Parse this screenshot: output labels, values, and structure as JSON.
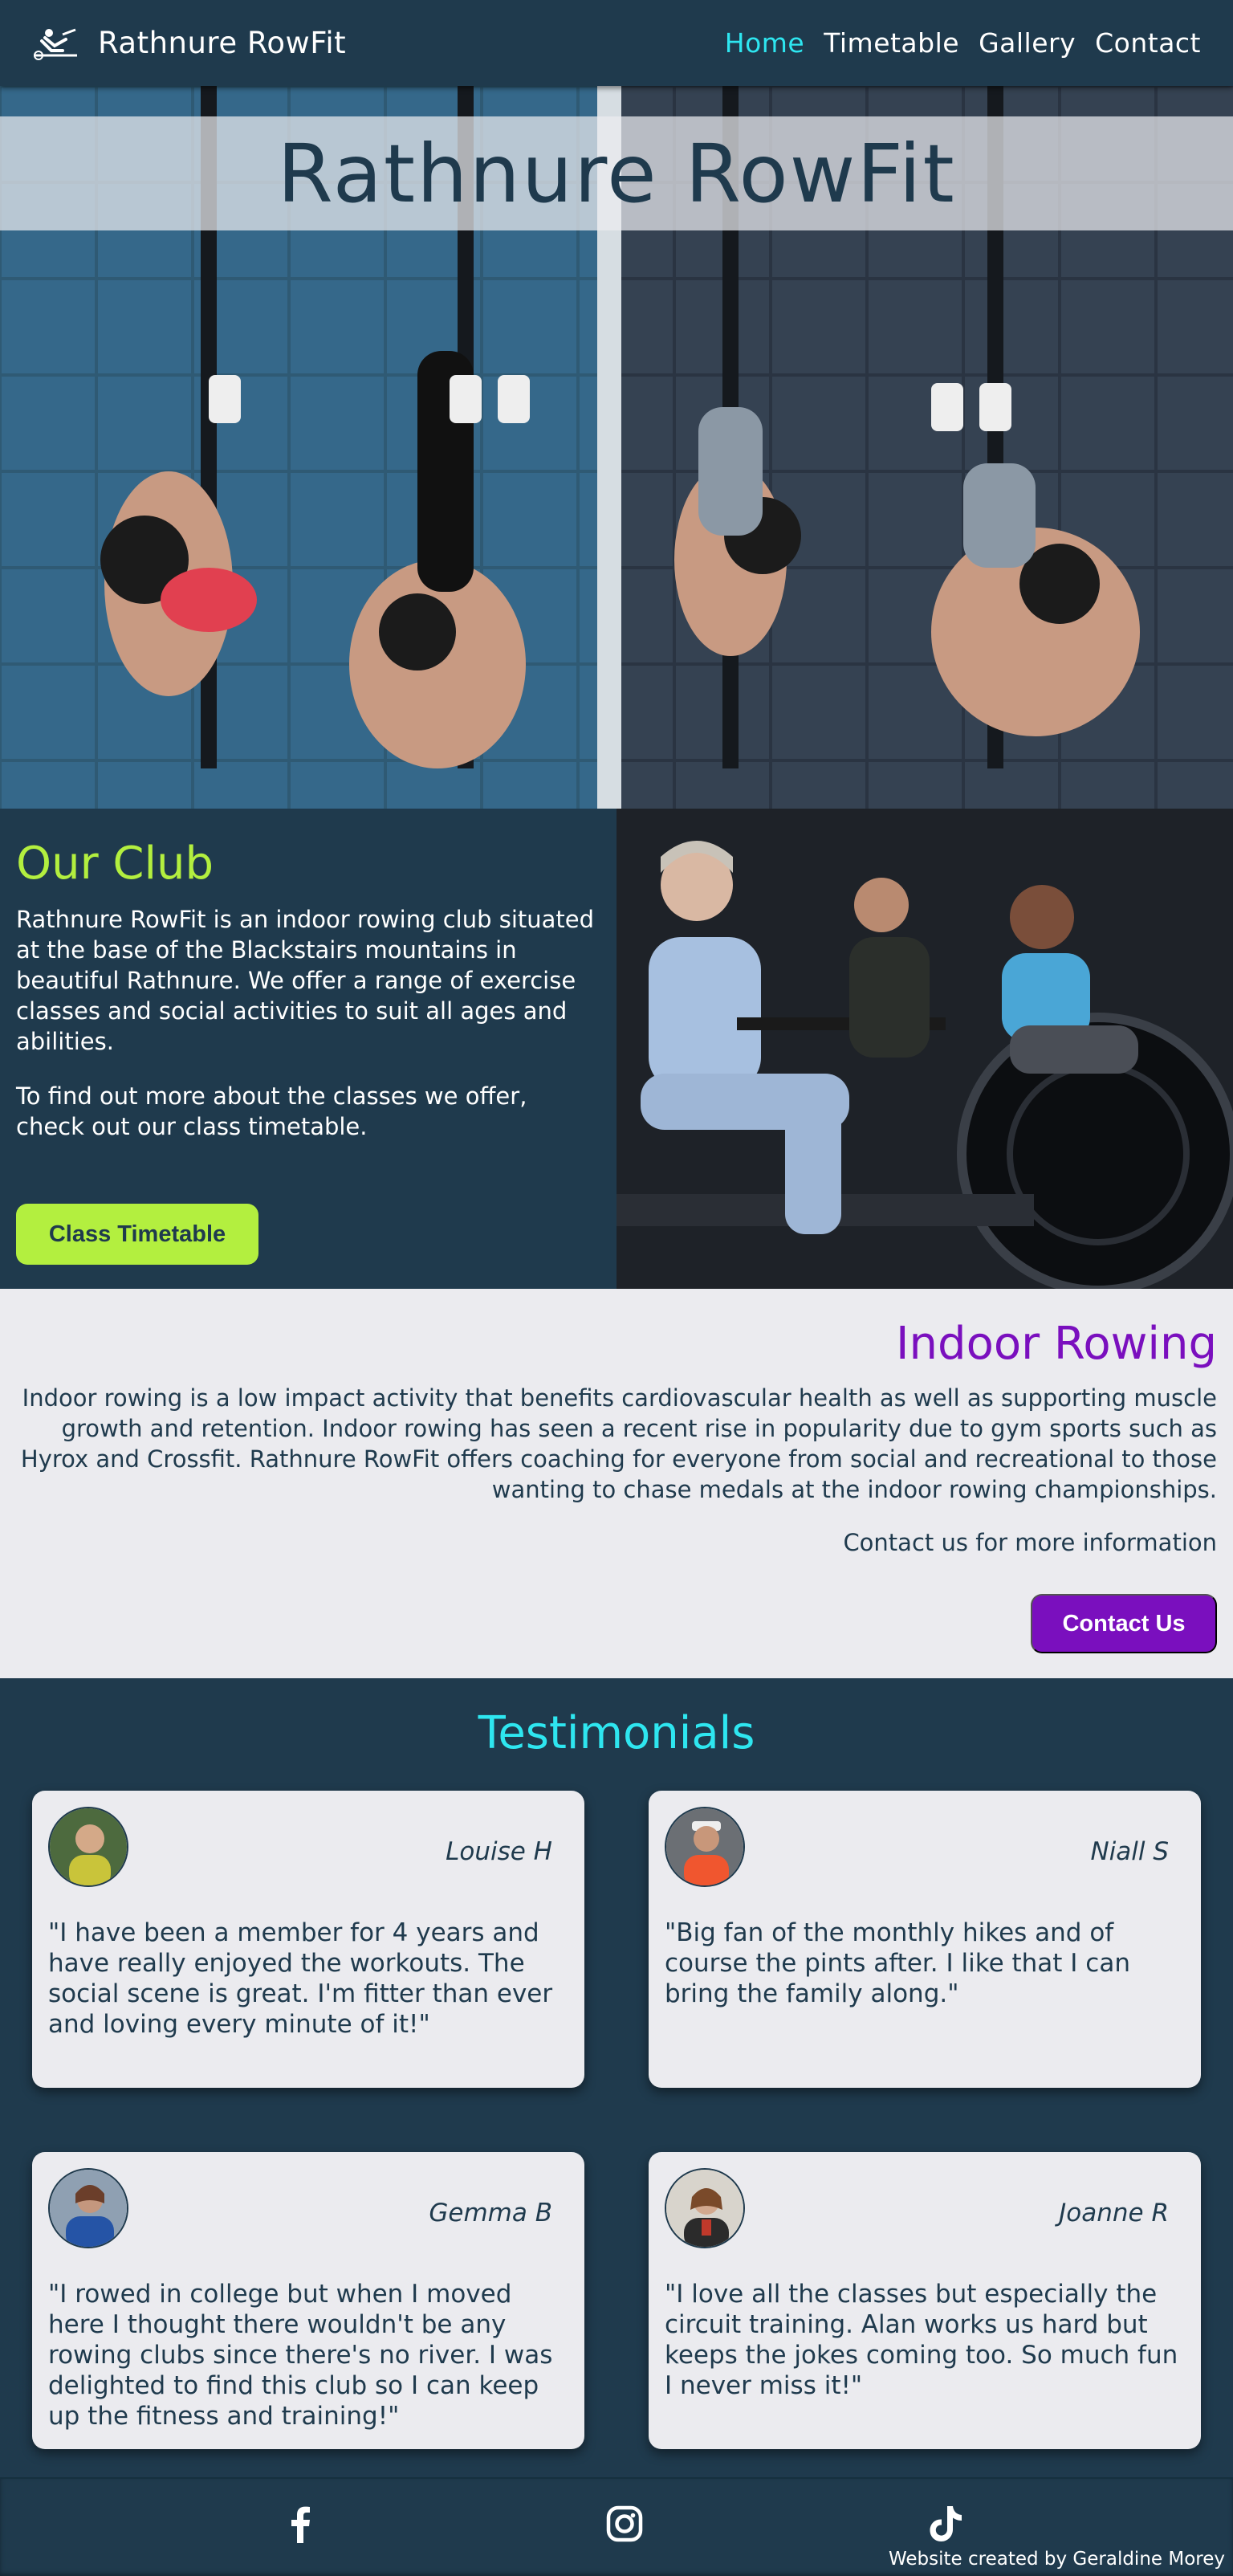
{
  "nav": {
    "brand": "Rathnure RowFit",
    "links": [
      "Home",
      "Timetable",
      "Gallery",
      "Contact"
    ]
  },
  "hero": {
    "title": "Rathnure RowFit"
  },
  "club": {
    "heading": "Our Club",
    "para1": "Rathnure RowFit is an indoor rowing club situated at the base of the Blackstairs mountains in beautiful Rathnure. We offer a range of exercise classes and social activities to suit all ages and abilities.",
    "para2": "To find out more about the classes we offer, check out our class timetable.",
    "button": "Class Timetable"
  },
  "rowing": {
    "heading": "Indoor Rowing",
    "para": "Indoor rowing is a low impact activity that benefits cardiovascular health as well as supporting muscle growth and retention. Indoor rowing has seen a recent rise in popularity due to gym sports such as Hyrox and Crossfit. Rathnure RowFit offers coaching for everyone from social and recreational to those wanting to chase medals at the indoor rowing championships.",
    "contact_text": "Contact us for more information",
    "button": "Contact Us"
  },
  "testimonials": {
    "heading": "Testimonials",
    "items": [
      {
        "name": "Louise H",
        "quote": "\"I have been a member for 4 years and have really enjoyed the workouts. The social scene is great. I'm fitter than ever and loving every minute of it!\""
      },
      {
        "name": "Niall S",
        "quote": "\"Big fan of the monthly hikes and of course the pints after. I like that I can bring the family along.\""
      },
      {
        "name": "Gemma B",
        "quote": "\"I rowed in college but when I moved here I thought there wouldn't be any rowing clubs since there's no river. I was delighted to find this club so I can keep up the fitness and training!\""
      },
      {
        "name": "Joanne R",
        "quote": "\"I love all the classes but especially the circuit training. Alan works us hard but keeps the jokes coming too. So much fun I never miss it!\""
      }
    ]
  },
  "footer": {
    "icons": [
      "facebook-icon",
      "instagram-icon",
      "tiktok-icon"
    ],
    "credit": "Website created by Geraldine Morey"
  },
  "colors": {
    "navy": "#1f3a4d",
    "cyan": "#2ee6f0",
    "lime": "#b3ef3f",
    "purple": "#7a0fbe",
    "light": "#ebebef"
  }
}
